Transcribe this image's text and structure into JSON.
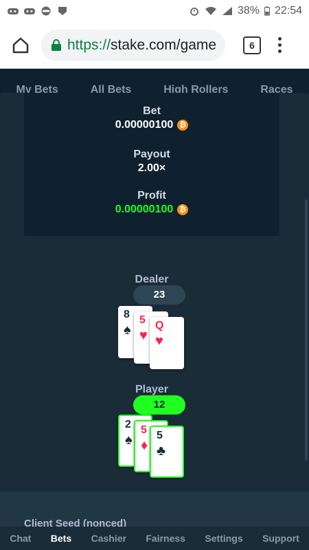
{
  "status_bar": {
    "battery": "38%",
    "time": "22:54",
    "icons": [
      "notification-game-icon",
      "notification-game-icon",
      "notification-shield-icon",
      "alarm-icon",
      "wifi-icon",
      "signal-icon",
      "battery-icon"
    ]
  },
  "browser": {
    "url_scheme": "https://",
    "url_rest": "stake.com/game",
    "tab_count": "6"
  },
  "bet_tabs": [
    "My Bets",
    "All Bets",
    "High Rollers",
    "Races"
  ],
  "summary": {
    "bet_label": "Bet",
    "bet_value": "0.00000100",
    "payout_label": "Payout",
    "payout_value": "2.00×",
    "profit_label": "Profit",
    "profit_value": "0.00000100",
    "currency_glyph": "₿"
  },
  "dealer": {
    "label": "Dealer",
    "total": "23",
    "cards": [
      {
        "rank": "8",
        "suit": "♠",
        "color": "black"
      },
      {
        "rank": "5",
        "suit": "♥",
        "color": "red"
      },
      {
        "rank": "Q",
        "suit": "♥",
        "color": "red"
      }
    ]
  },
  "player": {
    "label": "Player",
    "total": "12",
    "cards": [
      {
        "rank": "2",
        "suit": "♠",
        "color": "black"
      },
      {
        "rank": "5",
        "suit": "♦",
        "color": "red"
      },
      {
        "rank": "5",
        "suit": "♣",
        "color": "black"
      }
    ]
  },
  "seed_label": "Client Seed (nonced)",
  "bottom_nav": [
    "Chat",
    "Bets",
    "Cashier",
    "Fairness",
    "Settings",
    "Support"
  ],
  "bottom_nav_active": "Bets",
  "colors": {
    "win_green": "#1fff20",
    "card_red": "#fe2247",
    "bitcoin": "#f7931a"
  }
}
